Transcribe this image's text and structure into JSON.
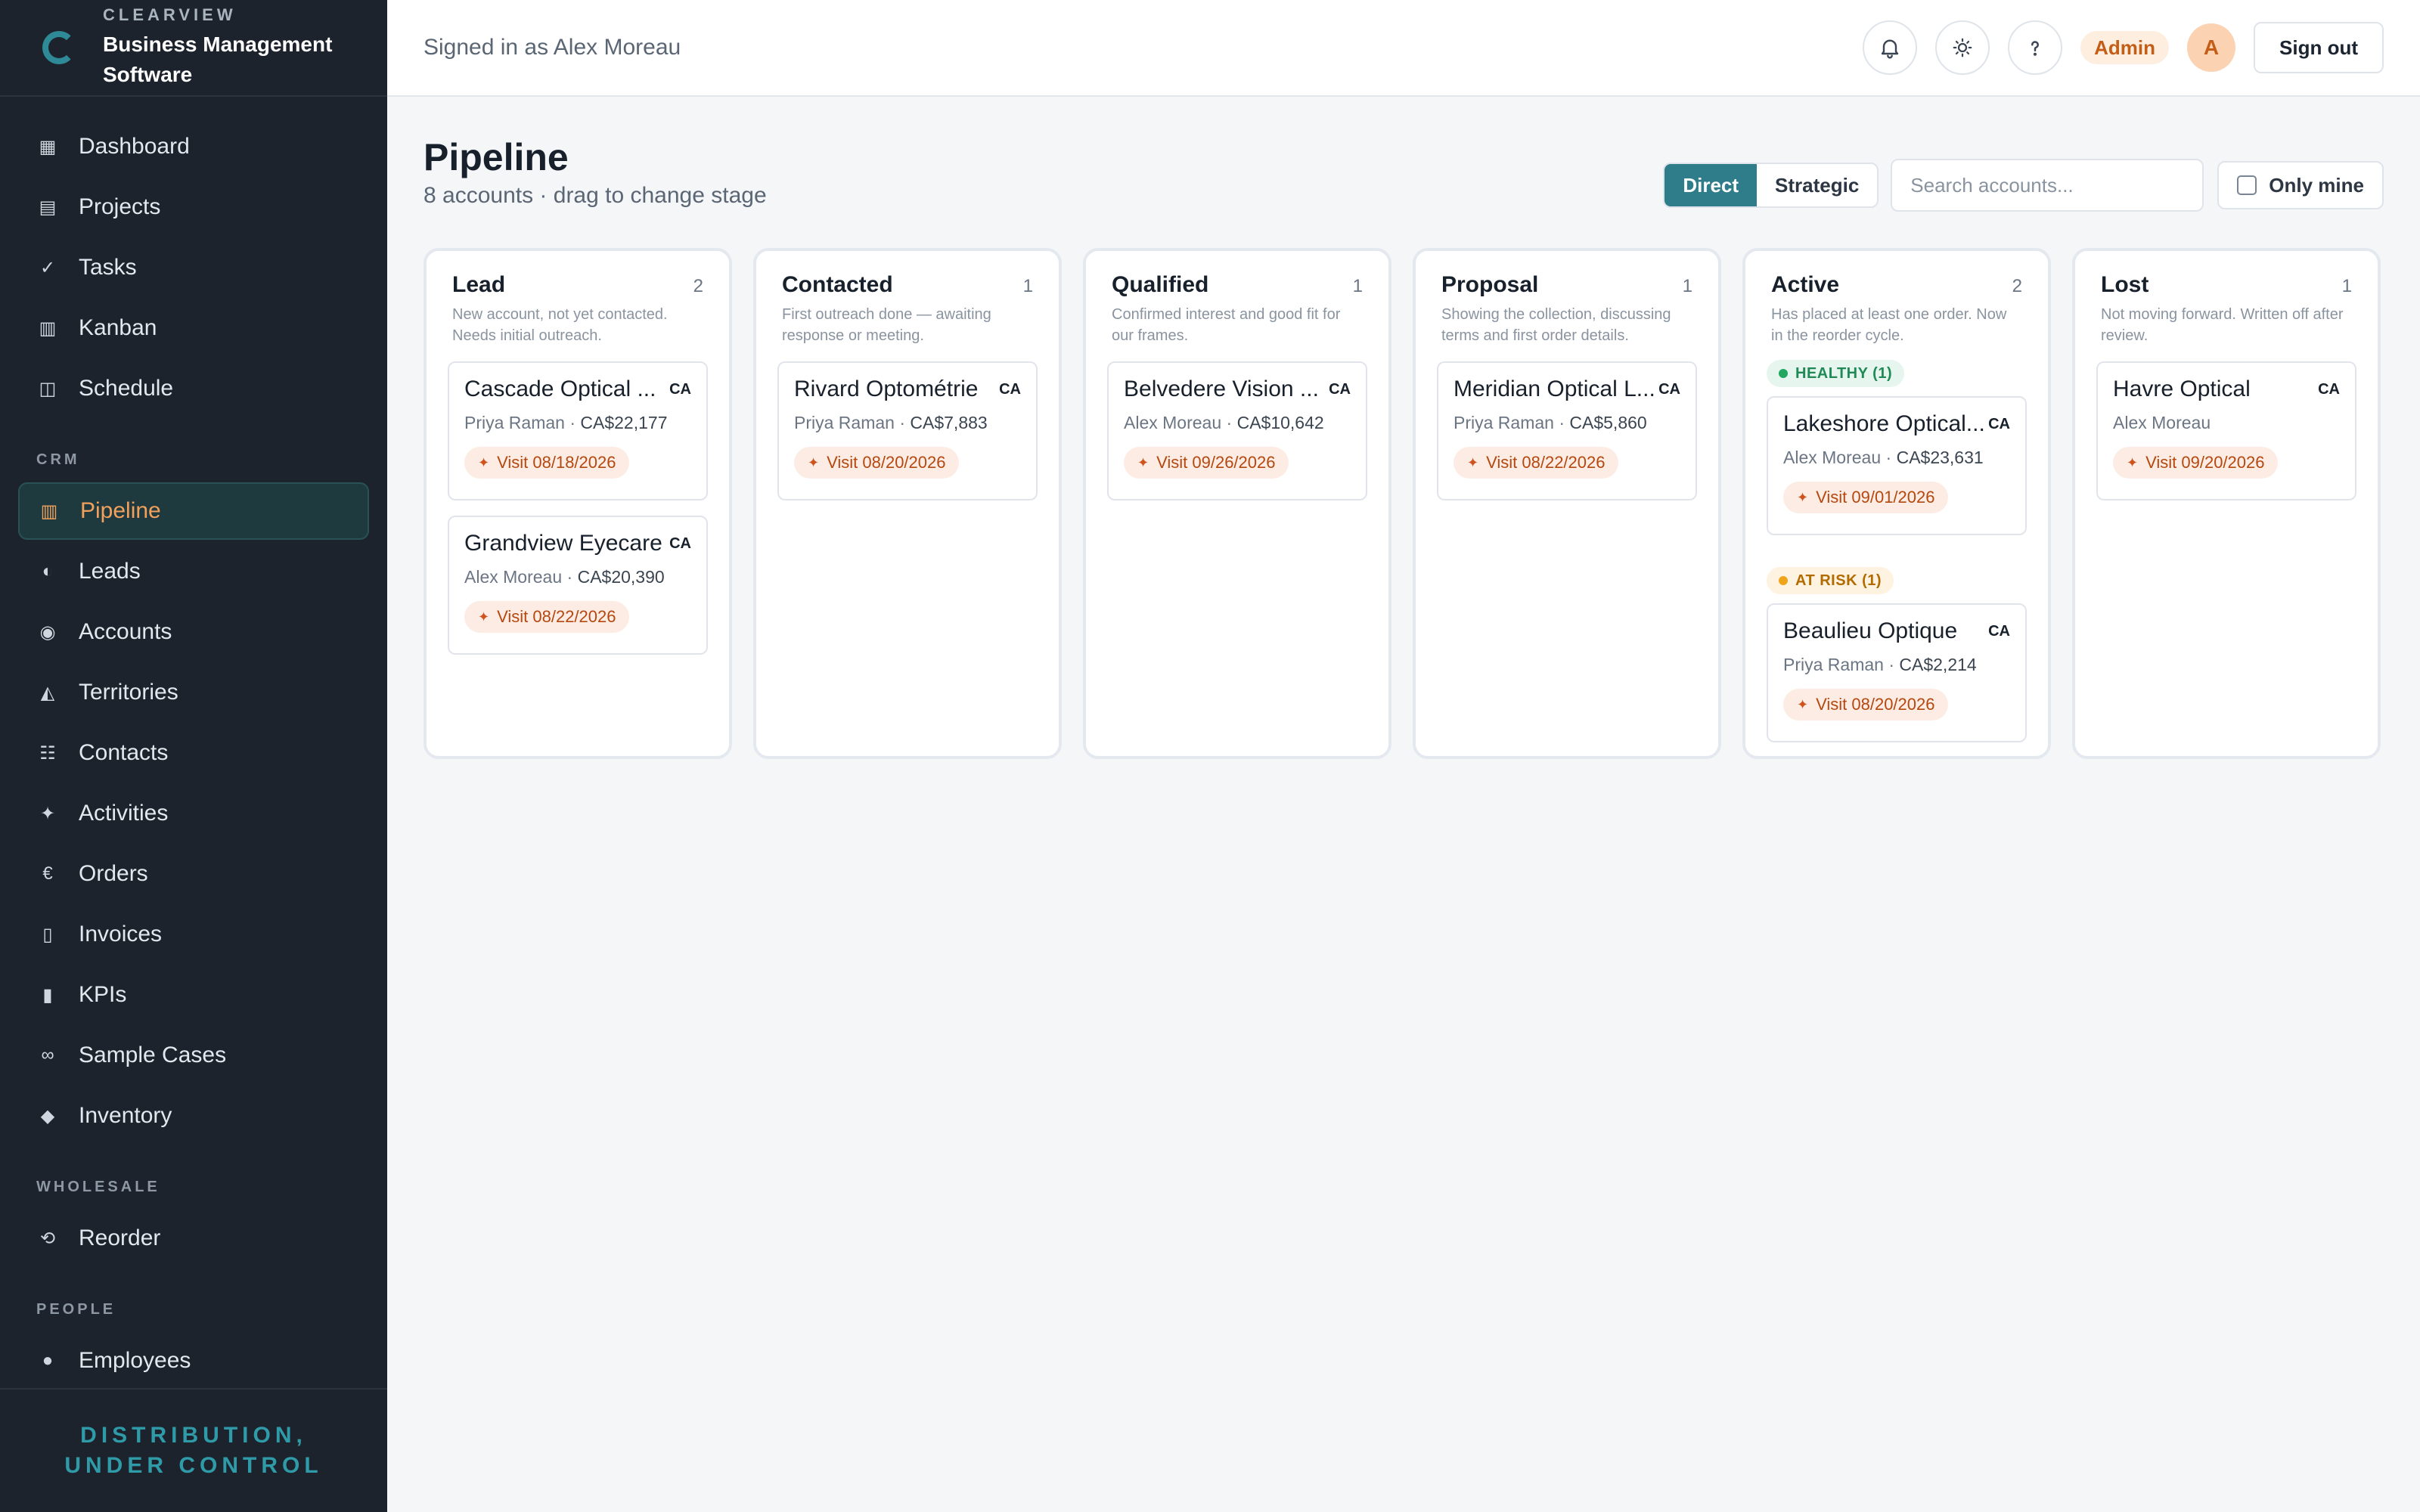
{
  "brand": {
    "kicker": "CLEARVIEW",
    "name": "Business Management Software",
    "tagline": "DISTRIBUTION, UNDER CONTROL",
    "accent_color": "#2f8a97"
  },
  "sidebar": {
    "items": [
      {
        "label": "Dashboard",
        "icon": "dashboard-icon",
        "glyph": "▦"
      },
      {
        "label": "Projects",
        "icon": "projects-icon",
        "glyph": "▤"
      },
      {
        "label": "Tasks",
        "icon": "tasks-icon",
        "glyph": "✓"
      },
      {
        "label": "Kanban",
        "icon": "kanban-icon",
        "glyph": "▥"
      },
      {
        "label": "Schedule",
        "icon": "schedule-icon",
        "glyph": "◫"
      }
    ],
    "crm_section": "CRM",
    "crm_items": [
      {
        "label": "Pipeline",
        "icon": "pipeline-icon",
        "glyph": "▥",
        "active": true
      },
      {
        "label": "Leads",
        "icon": "leads-icon",
        "glyph": "◐"
      },
      {
        "label": "Accounts",
        "icon": "accounts-icon",
        "glyph": "◉"
      },
      {
        "label": "Territories",
        "icon": "territories-icon",
        "glyph": "◭"
      },
      {
        "label": "Contacts",
        "icon": "contacts-icon",
        "glyph": "☷"
      },
      {
        "label": "Activities",
        "icon": "activities-icon",
        "glyph": "✦"
      },
      {
        "label": "Orders",
        "icon": "orders-icon",
        "glyph": "€"
      },
      {
        "label": "Invoices",
        "icon": "invoices-icon",
        "glyph": "▯"
      },
      {
        "label": "KPIs",
        "icon": "kpis-icon",
        "glyph": "▮"
      },
      {
        "label": "Sample Cases",
        "icon": "sample-cases-icon",
        "glyph": "∞"
      },
      {
        "label": "Inventory",
        "icon": "inventory-icon",
        "glyph": "◆"
      }
    ],
    "wholesale_section": "WHOLESALE",
    "wholesale_items": [
      {
        "label": "Reorder",
        "icon": "reorder-icon",
        "glyph": "⟲"
      }
    ],
    "people_section": "PEOPLE",
    "people_items": [
      {
        "label": "Employees",
        "icon": "employees-icon",
        "glyph": "●"
      }
    ]
  },
  "topbar": {
    "signed_in": "Signed in as Alex Moreau",
    "role_badge": "Admin",
    "avatar_initial": "A",
    "sign_out": "Sign out"
  },
  "page": {
    "title": "Pipeline",
    "subtitle": "8 accounts · drag to change stage",
    "segments": [
      "Direct",
      "Strategic"
    ],
    "selected_segment": "Direct",
    "search_placeholder": "Search accounts...",
    "only_mine": "Only mine"
  },
  "columns": [
    {
      "title": "Lead",
      "count": "2",
      "desc": "New account, not yet contacted. Needs initial outreach.",
      "cards": [
        {
          "name": "Cascade Optical ...",
          "country": "CA",
          "owner": "Priya Raman",
          "amount": "CA$22,177",
          "visit": "Visit 08/18/2026"
        },
        {
          "name": "Grandview Eyecare",
          "country": "CA",
          "owner": "Alex Moreau",
          "amount": "CA$20,390",
          "visit": "Visit 08/22/2026"
        }
      ]
    },
    {
      "title": "Contacted",
      "count": "1",
      "desc": "First outreach done — awaiting response or meeting.",
      "cards": [
        {
          "name": "Rivard Optométrie",
          "country": "CA",
          "owner": "Priya Raman",
          "amount": "CA$7,883",
          "visit": "Visit 08/20/2026"
        }
      ]
    },
    {
      "title": "Qualified",
      "count": "1",
      "desc": "Confirmed interest and good fit for our frames.",
      "cards": [
        {
          "name": "Belvedere Vision ...",
          "country": "CA",
          "owner": "Alex Moreau",
          "amount": "CA$10,642",
          "visit": "Visit 09/26/2026"
        }
      ]
    },
    {
      "title": "Proposal",
      "count": "1",
      "desc": "Showing the collection, discussing terms and first order details.",
      "cards": [
        {
          "name": "Meridian Optical L...",
          "country": "CA",
          "owner": "Priya Raman",
          "amount": "CA$5,860",
          "visit": "Visit 08/22/2026"
        }
      ]
    },
    {
      "title": "Active",
      "count": "2",
      "desc": "Has placed at least one order. Now in the reorder cycle.",
      "healthy_label": "HEALTHY (1)",
      "healthy_card": {
        "name": "Lakeshore Optical...",
        "country": "CA",
        "owner": "Alex Moreau",
        "amount": "CA$23,631",
        "visit": "Visit 09/01/2026"
      },
      "risk_label": "AT RISK (1)",
      "risk_card": {
        "name": "Beaulieu Optique",
        "country": "CA",
        "owner": "Priya Raman",
        "amount": "CA$2,214",
        "visit": "Visit 08/20/2026"
      }
    },
    {
      "title": "Lost",
      "count": "1",
      "desc": "Not moving forward. Written off after review.",
      "cards": [
        {
          "name": "Havre Optical",
          "country": "CA",
          "owner": "Alex Moreau",
          "amount": "",
          "visit": "Visit 09/20/2026"
        }
      ]
    }
  ]
}
